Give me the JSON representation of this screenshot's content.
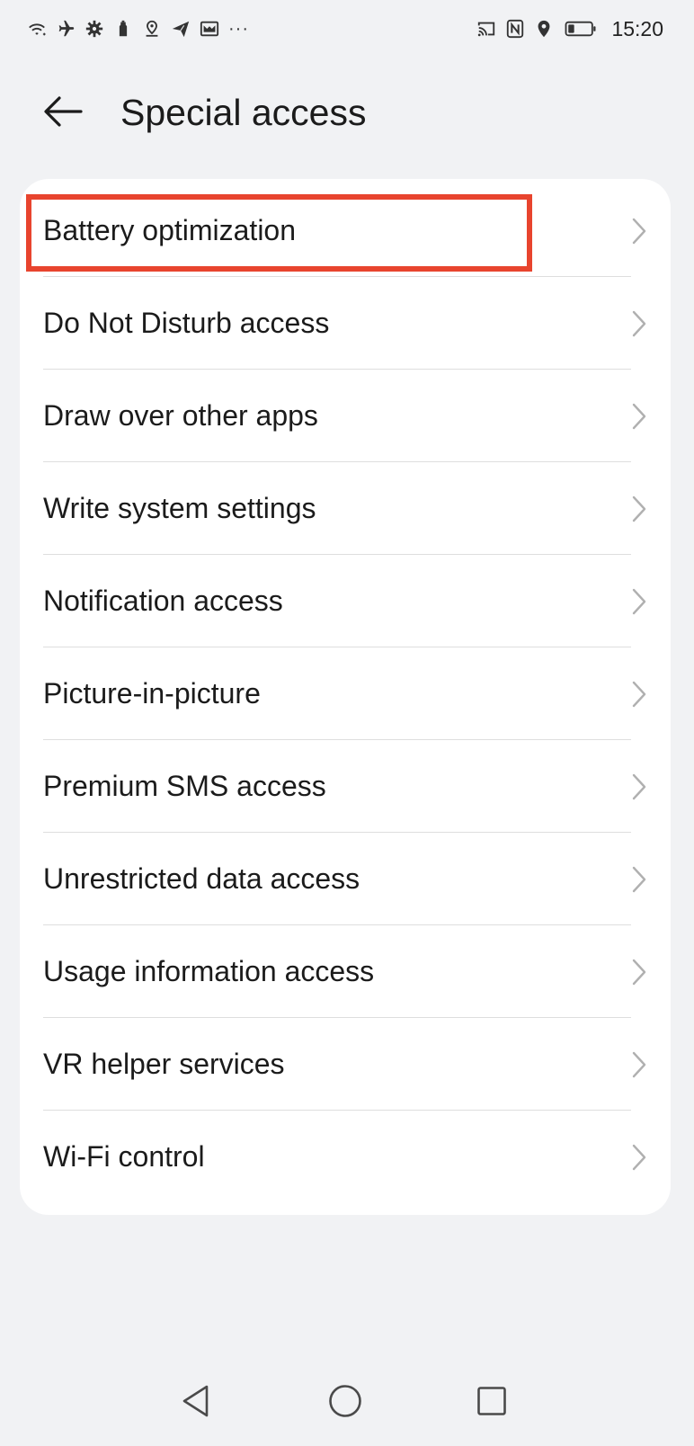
{
  "status_bar": {
    "icons_left": [
      "wifi-icon",
      "airplane-icon",
      "settings-gear-icon",
      "notification-icon",
      "location-icon",
      "send-icon",
      "mail-icon"
    ],
    "more": "···",
    "icons_right": [
      "cast-icon",
      "nfc-icon",
      "location-pin-icon",
      "battery-icon"
    ],
    "time": "15:20"
  },
  "header": {
    "title": "Special access"
  },
  "list": {
    "items": [
      {
        "label": "Battery optimization"
      },
      {
        "label": "Do Not Disturb access"
      },
      {
        "label": "Draw over other apps"
      },
      {
        "label": "Write system settings"
      },
      {
        "label": "Notification access"
      },
      {
        "label": "Picture-in-picture"
      },
      {
        "label": "Premium SMS access"
      },
      {
        "label": "Unrestricted data access"
      },
      {
        "label": "Usage information access"
      },
      {
        "label": "VR helper services"
      },
      {
        "label": "Wi-Fi control"
      }
    ]
  },
  "nav_bar": {
    "buttons": [
      "back-triangle-icon",
      "home-circle-icon",
      "recents-square-icon"
    ]
  },
  "colors": {
    "background": "#f1f2f4",
    "card": "#ffffff",
    "highlight": "#e8442e",
    "chevron": "#b0b0b0"
  }
}
